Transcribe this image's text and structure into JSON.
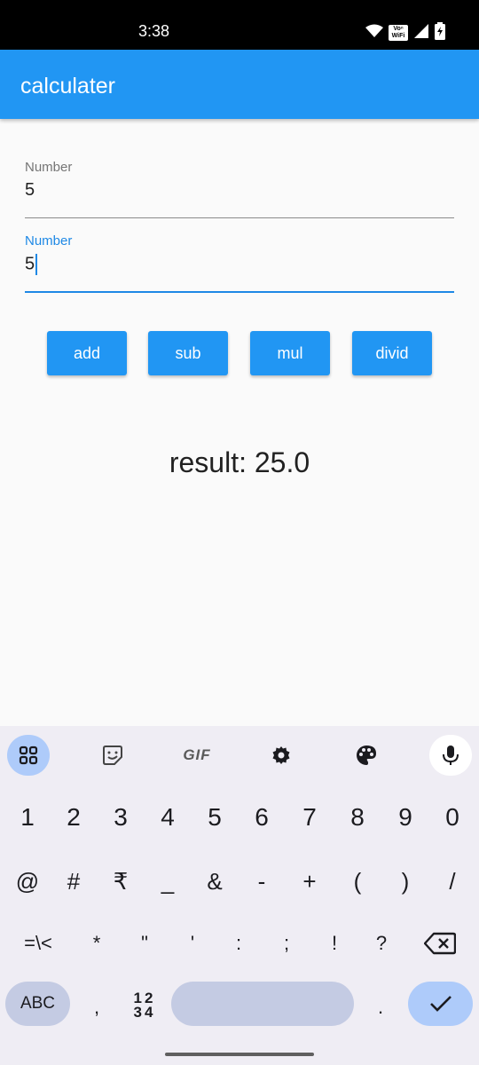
{
  "status_bar": {
    "time": "3:38",
    "volte_label": "Vo LTE\nWiFi",
    "volte_top": "Voⁿ",
    "volte_bottom": "WiFi"
  },
  "app_bar": {
    "title": "calculater"
  },
  "inputs": [
    {
      "label": "Number",
      "value": "5"
    },
    {
      "label": "Number",
      "value": "5"
    }
  ],
  "buttons": {
    "add": "add",
    "sub": "sub",
    "mul": "mul",
    "divid": "divid"
  },
  "result": {
    "text": "result: 25.0"
  },
  "keyboard": {
    "toolbar": [
      "apps-icon",
      "sticker-icon",
      "gif-button",
      "settings-icon",
      "palette-icon",
      "mic-icon"
    ],
    "gif_label": "GIF",
    "row1": [
      "1",
      "2",
      "3",
      "4",
      "5",
      "6",
      "7",
      "8",
      "9",
      "0"
    ],
    "row2": [
      "@",
      "#",
      "₹",
      "_",
      "&",
      "-",
      "+",
      "(",
      ")",
      "/"
    ],
    "row3": [
      "=\\<",
      "*",
      "\"",
      "'",
      ":",
      ";",
      "!",
      "?"
    ],
    "abc_label": "ABC",
    "comma": ",",
    "numpad_top": "12",
    "numpad_bottom": "34",
    "period": "."
  },
  "colors": {
    "primary": "#2196f3",
    "focused": "#1e88e5",
    "keyboard_bg": "#efedf4",
    "key_accent": "#c4cbe3",
    "enter": "#aecbfa"
  }
}
